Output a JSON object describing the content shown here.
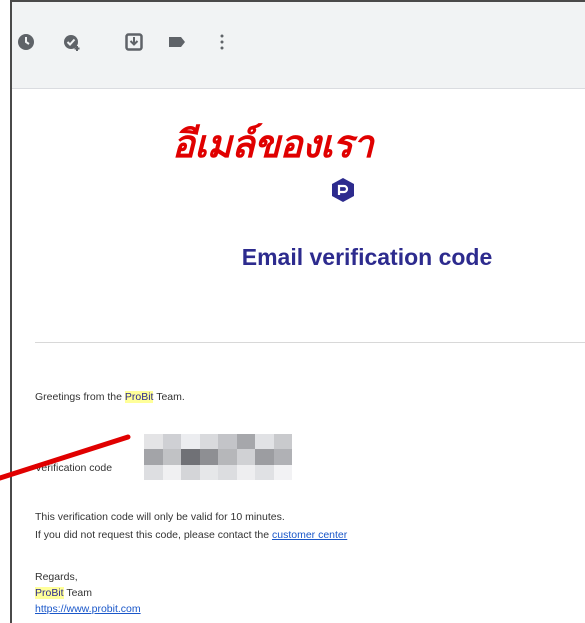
{
  "toolbar": {
    "icons": [
      "clock-icon",
      "add-task-icon",
      "move-to-icon",
      "label-icon",
      "more-vertical-icon"
    ]
  },
  "caption": {
    "text": "อีเมล์ของเรา"
  },
  "email": {
    "heading": "Email verification code",
    "greeting_prefix": "Greetings from the ",
    "greeting_brand": "ProBit",
    "greeting_suffix": " Team.",
    "verification_label": "Verification code",
    "validity_text": "This verification code will only be valid for 10 minutes.",
    "request_prefix": "If you did not request this code, please contact the ",
    "request_link": "customer center",
    "regards": "Regards,",
    "sign_brand": "ProBit",
    "sign_team": " Team",
    "website": "https://www.probit.com"
  },
  "colors": {
    "heading": "#2d2b8e",
    "annotation": "#e00000",
    "highlight": "#ffff99",
    "link": "#1a57c9"
  }
}
